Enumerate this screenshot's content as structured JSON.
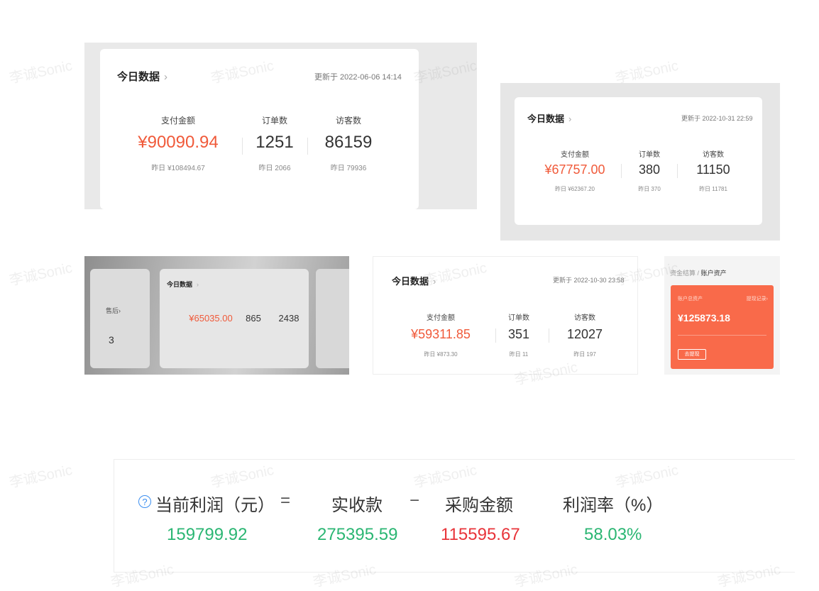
{
  "common": {
    "chevron": "›",
    "labels": {
      "pay": "支付金额",
      "orders": "订单数",
      "visitors": "访客数"
    },
    "watermark": "李诚Sonic"
  },
  "card1": {
    "title": "今日数据",
    "updated": "更新于 2022-06-06 14:14",
    "pay": "¥90090.94",
    "pay_y": "昨日 ¥108494.67",
    "orders": "1251",
    "orders_y": "昨日 2066",
    "visitors": "86159",
    "visitors_y": "昨日 79936"
  },
  "card2": {
    "title": "今日数据",
    "updated": "更新于 2022-10-31 22:59",
    "pay": "¥67757.00",
    "pay_y": "昨日 ¥62367.20",
    "orders": "380",
    "orders_y": "昨日 370",
    "visitors": "11150",
    "visitors_y": "昨日 11781"
  },
  "card3": {
    "title": "今日数据",
    "side_label": "售后",
    "side_value": "3",
    "pay": "¥65035.00",
    "orders": "865",
    "visitors": "2438"
  },
  "card4": {
    "title": "今日数据",
    "updated": "更新于 2022-10-30 23:58",
    "pay": "¥59311.85",
    "pay_y": "昨日 ¥873.30",
    "orders": "351",
    "orders_y": "昨日 11",
    "visitors": "12027",
    "visitors_y": "昨日 197"
  },
  "card5": {
    "breadcrumb_parent": "资金结算",
    "breadcrumb_sep": "/",
    "breadcrumb_current": "账户资产",
    "asset_title": "账户总资产",
    "asset_link": "提现记录",
    "asset_amount": "¥125873.18",
    "withdraw_button": "去提现"
  },
  "formula": {
    "help_icon": "?",
    "profit_label": "当前利润（元）",
    "eq": "=",
    "received_label": "实收款",
    "minus": "−",
    "purchase_label": "采购金额",
    "rate_label": "利润率（%）",
    "profit_value": "159799.92",
    "received_value": "275395.59",
    "purchase_value": "115595.67",
    "rate_value": "58.03%"
  },
  "colors": {
    "accent_red": "#f05a3a",
    "green": "#2bb673",
    "crimson": "#e8343a",
    "asset_orange": "#f96a4a"
  }
}
